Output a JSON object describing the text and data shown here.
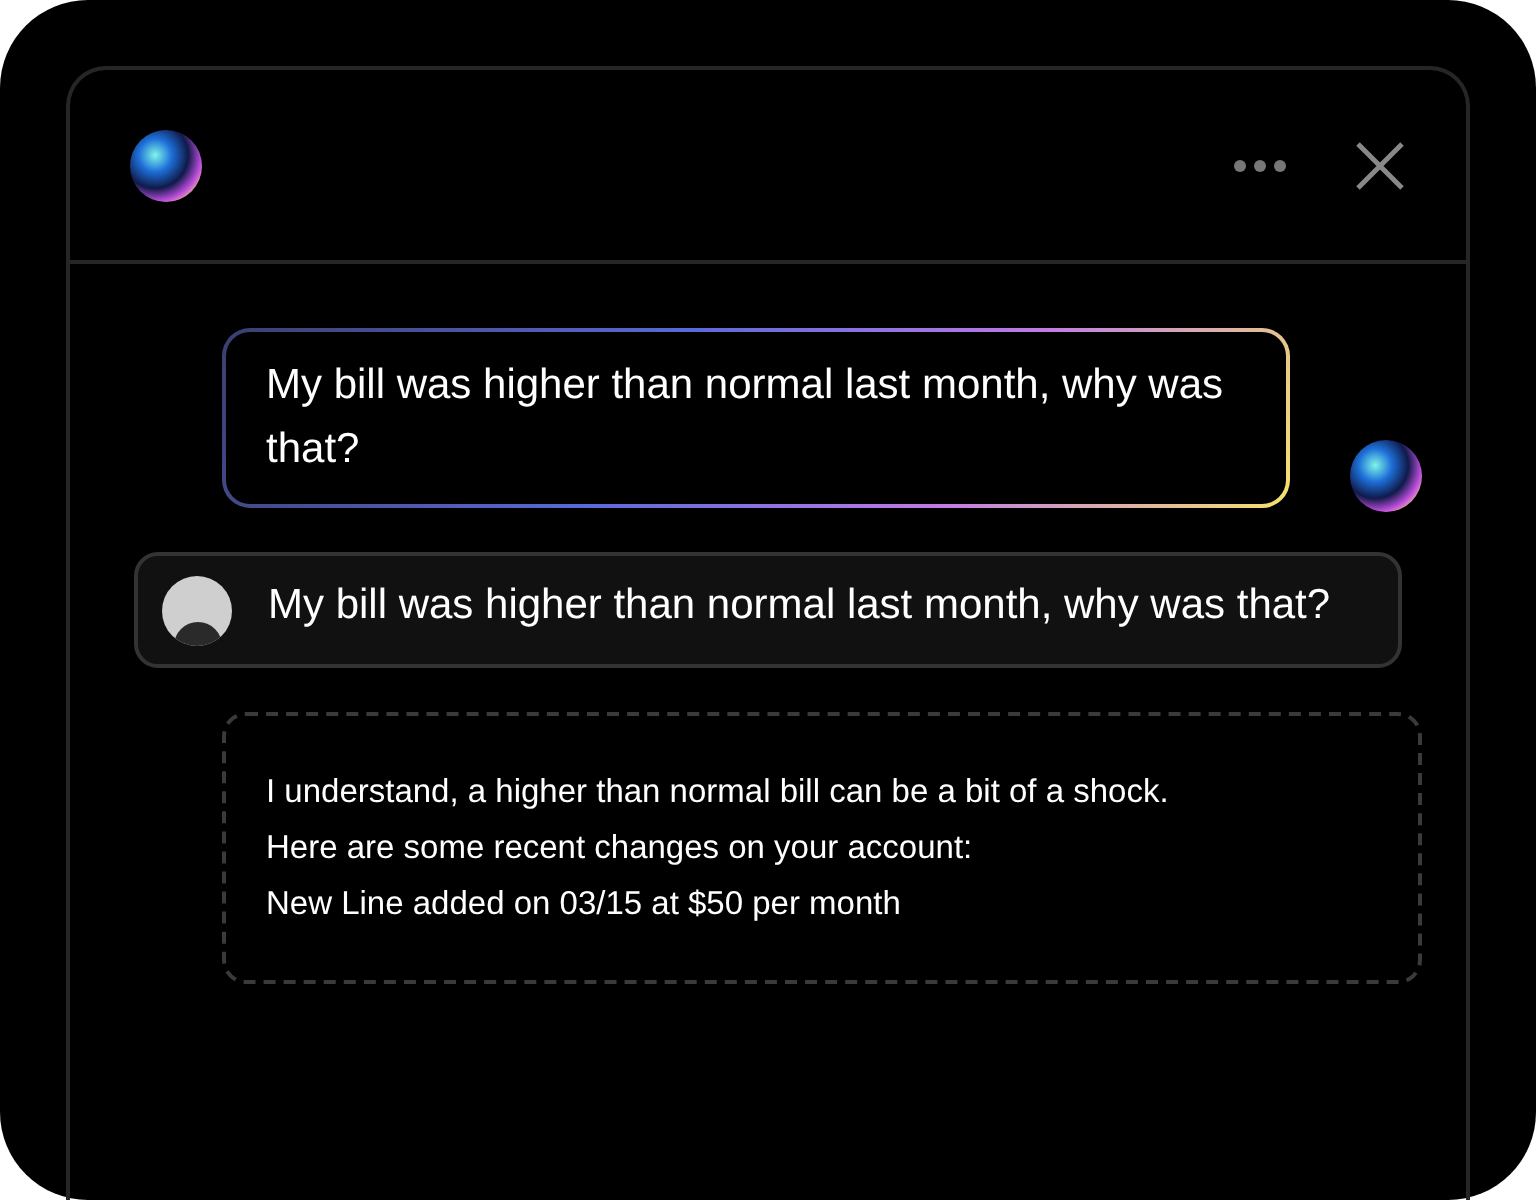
{
  "messages": [
    {
      "kind": "prompt",
      "text": "My bill was higher than normal last month, why was that?"
    },
    {
      "kind": "user",
      "text": "My bill was higher than normal last month, why was that?"
    },
    {
      "kind": "assistant",
      "lines": [
        "I understand, a higher than normal bill can be a bit of a shock.",
        "Here are some recent changes on your account:",
        "New Line added on 03/15 at $50 per month"
      ]
    }
  ]
}
